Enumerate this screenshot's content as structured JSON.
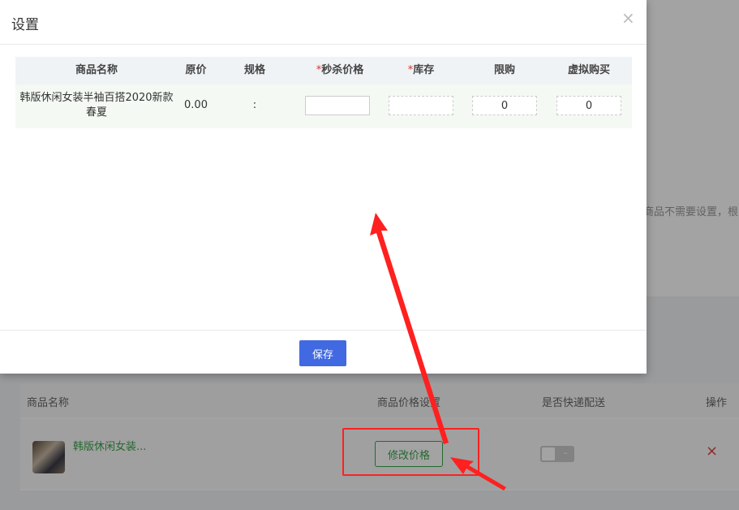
{
  "modal": {
    "title": "设置",
    "close_icon": "×",
    "columns": [
      "商品名称",
      "原价",
      "规格",
      "秒杀价格",
      "库存",
      "限购",
      "虚拟购买"
    ],
    "required_marker": "*",
    "row": {
      "name": "韩版休闲女装半袖百搭2020新款春夏",
      "original_price": "0.00",
      "spec": ":",
      "seckill_price": "",
      "stock": "",
      "limit": "0",
      "virtual_buy": "0"
    },
    "save_label": "保存"
  },
  "background": {
    "hint": "商品不需要设置，根",
    "columns": [
      "商品名称",
      "商品价格设置",
      "是否快递配送",
      "操作"
    ],
    "row": {
      "name": "韩版休闲女装...",
      "edit_price_label": "修改价格",
      "switch_text": "–",
      "delete_icon": "×"
    }
  },
  "colors": {
    "primary": "#4169e1",
    "green": "#3aa44a",
    "required": "#e03030",
    "annotation": "#ff2020"
  }
}
